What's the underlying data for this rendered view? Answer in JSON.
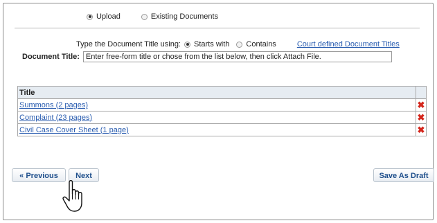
{
  "upload_mode": {
    "options": [
      {
        "label": "Upload",
        "selected": true
      },
      {
        "label": "Existing Documents",
        "selected": false
      }
    ]
  },
  "search": {
    "prompt": "Type the Document Title using:",
    "options": [
      {
        "label": "Starts with",
        "selected": true
      },
      {
        "label": "Contains",
        "selected": false
      }
    ],
    "court_link": "Court defined Document Titles"
  },
  "document_title": {
    "label": "Document Title:",
    "value": "Enter free-form title or chose from the list below, then click Attach File."
  },
  "table": {
    "header": "Title",
    "rows": [
      {
        "title": "Summons (2 pages)"
      },
      {
        "title": "Complaint (23 pages)"
      },
      {
        "title": "Civil Case Cover Sheet (1 page)"
      }
    ]
  },
  "buttons": {
    "previous": "« Previous",
    "next": "Next",
    "save_draft": "Save As Draft"
  },
  "icons": {
    "delete": "delete-x-icon",
    "cursor": "hand-pointer-icon"
  },
  "colors": {
    "link": "#2a5db0",
    "delete": "#d4261c",
    "header_bg": "#e6ecf2"
  }
}
